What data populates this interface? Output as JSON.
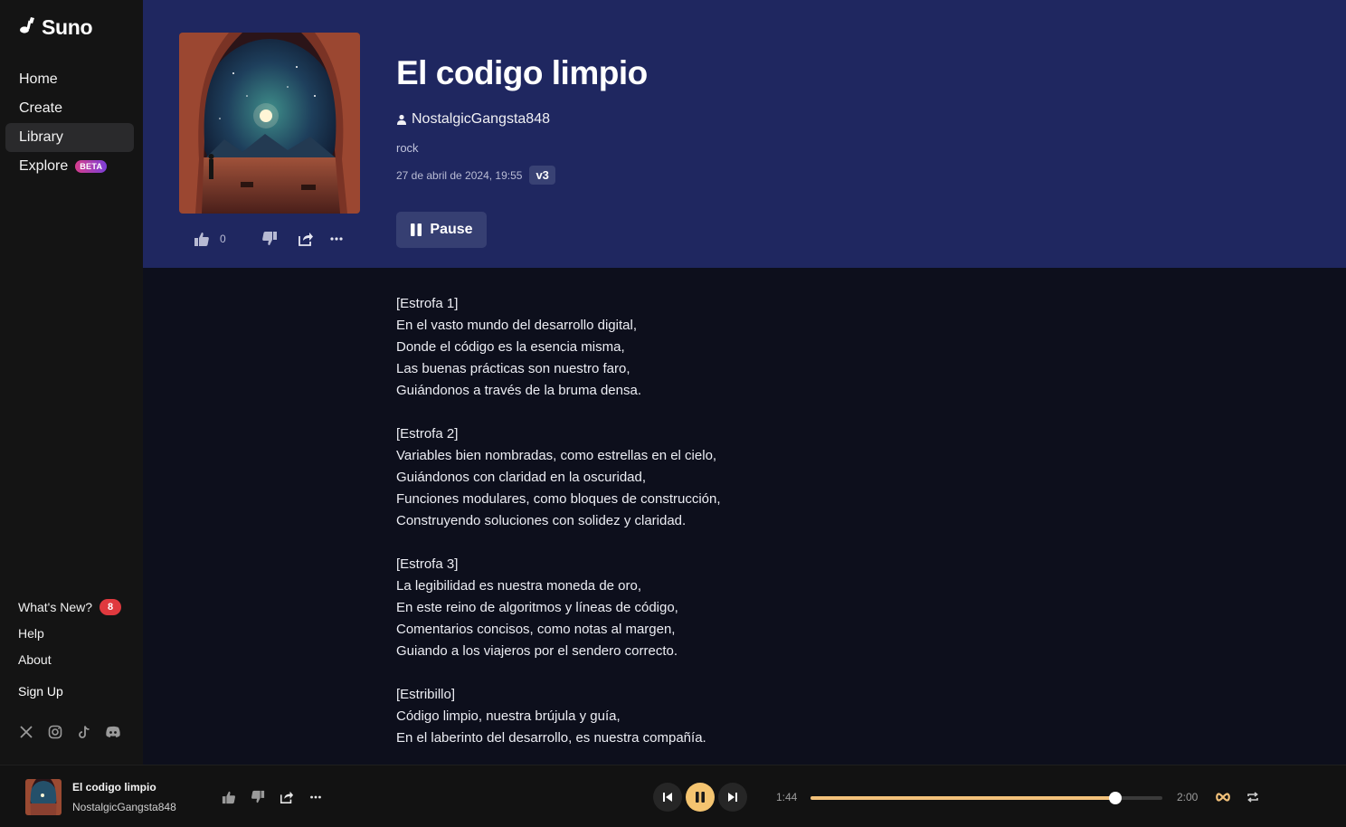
{
  "brand": {
    "name": "Suno"
  },
  "nav": [
    {
      "label": "Home",
      "active": false
    },
    {
      "label": "Create",
      "active": false
    },
    {
      "label": "Library",
      "active": true
    },
    {
      "label": "Explore",
      "active": false,
      "badge": "BETA"
    }
  ],
  "secondary_nav": {
    "whats_new": "What's New?",
    "whats_new_count": "8",
    "help": "Help",
    "about": "About",
    "sign_up": "Sign Up"
  },
  "socials": [
    "x-icon",
    "instagram-icon",
    "tiktok-icon",
    "discord-icon"
  ],
  "song": {
    "title": "El codigo limpio",
    "artist": "NostalgicGangsta848",
    "genre": "rock",
    "date": "27 de abril de 2024, 19:55",
    "version": "v3",
    "like_count": "0",
    "pause_label": "Pause"
  },
  "lyrics": [
    "[Estrofa 1]",
    "En el vasto mundo del desarrollo digital,",
    "Donde el código es la esencia misma,",
    "Las buenas prácticas son nuestro faro,",
    "Guiándonos a través de la bruma densa.",
    "",
    "[Estrofa 2]",
    "Variables bien nombradas, como estrellas en el cielo,",
    "Guiándonos con claridad en la oscuridad,",
    "Funciones modulares, como bloques de construcción,",
    "Construyendo soluciones con solidez y claridad.",
    "",
    "[Estrofa 3]",
    "La legibilidad es nuestra moneda de oro,",
    "En este reino de algoritmos y líneas de código,",
    "Comentarios concisos, como notas al margen,",
    "Guiando a los viajeros por el sendero correcto.",
    "",
    "[Estribillo]",
    "Código limpio, nuestra brújula y guía,",
    "En el laberinto del desarrollo, es nuestra compañía."
  ],
  "player": {
    "title": "El codigo limpio",
    "artist": "NostalgicGangsta848",
    "elapsed": "1:44",
    "duration": "2:00",
    "progress_fraction": 0.867
  },
  "colors": {
    "accent": "#f2c17a",
    "header_bg": "#1f2760",
    "page_bg": "#0d0f1c",
    "sidebar_bg": "#141414"
  }
}
